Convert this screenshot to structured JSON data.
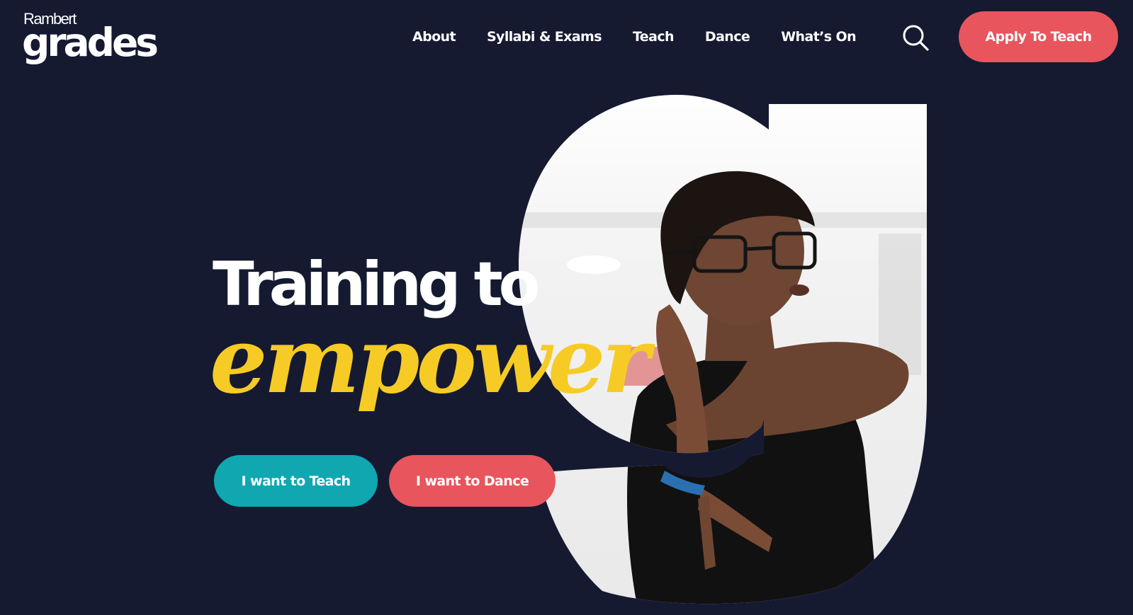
{
  "brand": {
    "top": "Rambert",
    "main": "grades"
  },
  "nav": {
    "items": [
      "About",
      "Syllabi & Exams",
      "Teach",
      "Dance",
      "What’s On"
    ],
    "search_icon": "search-icon",
    "apply_label": "Apply To Teach"
  },
  "hero": {
    "line1": "Training to",
    "line2": "empower",
    "image": "dancer-photo",
    "buttons": {
      "teach": "I want to Teach",
      "dance": "I want to Dance"
    }
  },
  "colors": {
    "background": "#151a31",
    "accent_red": "#e8555d",
    "accent_teal": "#10a7b1",
    "accent_yellow": "#f6cb25"
  }
}
